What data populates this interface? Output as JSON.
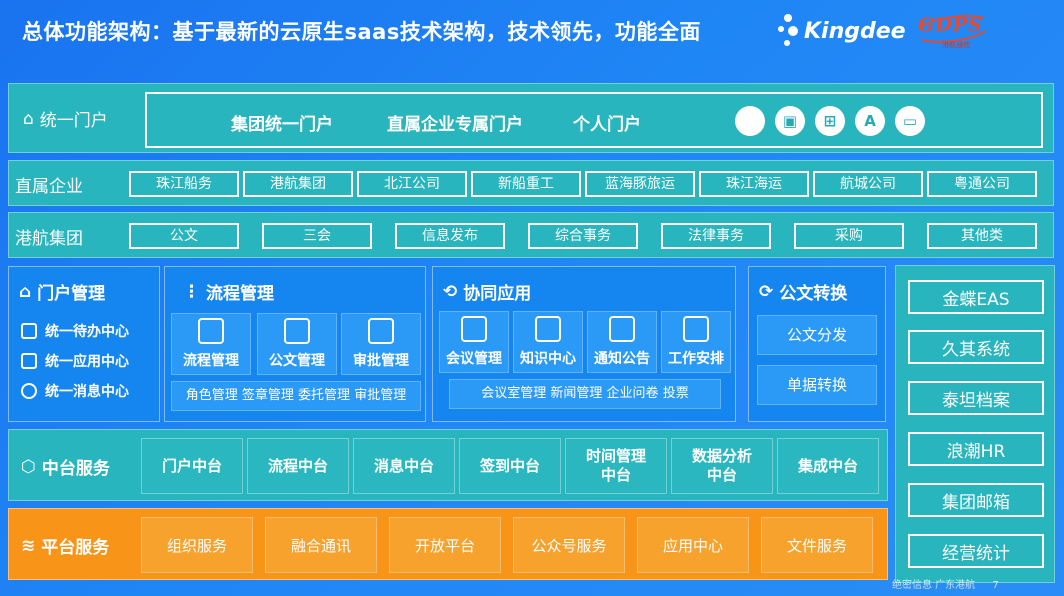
{
  "header": {
    "title": "总体功能架构：基于最新的云原生saas技术架构，技术领先，功能全面",
    "kingdee_logo_text": "Kingdee",
    "partner_logo_text": "GDPS",
    "partner_logo_subtext": "港航通信"
  },
  "portal": {
    "label": "统一门户",
    "items": [
      "集团统一门户",
      "直属企业专属门户",
      "个人门户"
    ],
    "platform_icons": [
      "apple-icon",
      "android-icon",
      "windows-icon",
      "app-store-icon",
      "browser-window-icon"
    ]
  },
  "direct_enterprises": {
    "label": "直属企业",
    "items": [
      "珠江船务",
      "港航集团",
      "北江公司",
      "新船重工",
      "蓝海豚旅运",
      "珠江海运",
      "航城公司",
      "粤通公司"
    ]
  },
  "group": {
    "label": "港航集团",
    "items": [
      "公文",
      "三会",
      "信息发布",
      "综合事务",
      "法律事务",
      "采购",
      "其他类"
    ]
  },
  "portal_mgmt": {
    "title": "门户管理",
    "items": [
      "统一待办中心",
      "统一应用中心",
      "统一消息中心"
    ]
  },
  "process_mgmt": {
    "title": "流程管理",
    "tiles": [
      "流程管理",
      "公文管理",
      "审批管理"
    ],
    "strip": "角色管理  签章管理  委托管理  审批管理"
  },
  "collab": {
    "title": "协同应用",
    "tiles": [
      "会议管理",
      "知识中心",
      "通知公告",
      "工作安排"
    ],
    "strip": "会议室管理  新闻管理  企业问卷  投票"
  },
  "doc_convert": {
    "title": "公文转换",
    "items": [
      "公文分发",
      "单据转换"
    ]
  },
  "middle_platform": {
    "label": "中台服务",
    "items": [
      "门户中台",
      "流程中台",
      "消息中台",
      "签到中台",
      "时间管理\n中台",
      "数据分析\n中台",
      "集成中台"
    ]
  },
  "platform_services": {
    "label": "平台服务",
    "items": [
      "组织服务",
      "融合通讯",
      "开放平台",
      "公众号服务",
      "应用中心",
      "文件服务"
    ]
  },
  "systems": {
    "items": [
      "金蝶EAS",
      "久其系统",
      "泰坦档案",
      "浪潮HR",
      "集团邮箱",
      "经营统计"
    ]
  },
  "footer": {
    "source": "绝密信息 广东港航",
    "page_number": "7"
  },
  "colors": {
    "background": "#1f86f5",
    "teal": "#29b5bd",
    "panel_blue": "#1585f0",
    "orange": "#f89418",
    "gdps_red": "#e5492e"
  }
}
